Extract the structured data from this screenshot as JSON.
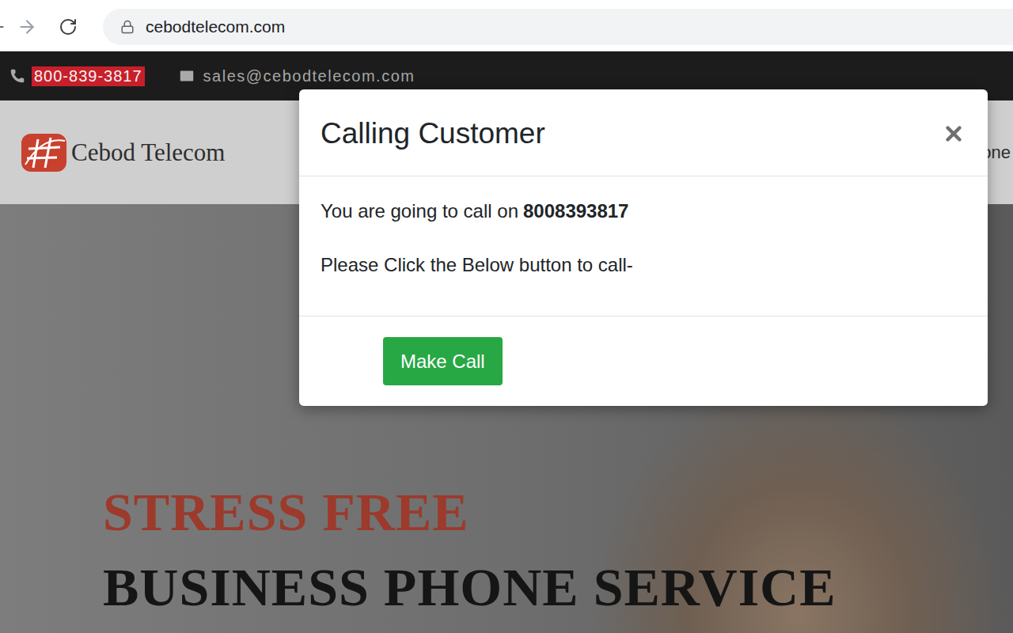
{
  "browser": {
    "url": "cebodtelecom.com"
  },
  "topbar": {
    "phone": "800-839-3817",
    "email": "sales@cebodtelecom.com"
  },
  "header": {
    "logo": "Cebod Telecom",
    "nav_fragment": "one"
  },
  "hero": {
    "headline": "STRESS FREE",
    "subheadline": "BUSINESS PHONE SERVICE"
  },
  "modal": {
    "title": "Calling Customer",
    "message": "You are going to call on",
    "number": "8008393817",
    "instruction": "Please Click the Below button to call-",
    "button": "Make Call"
  }
}
